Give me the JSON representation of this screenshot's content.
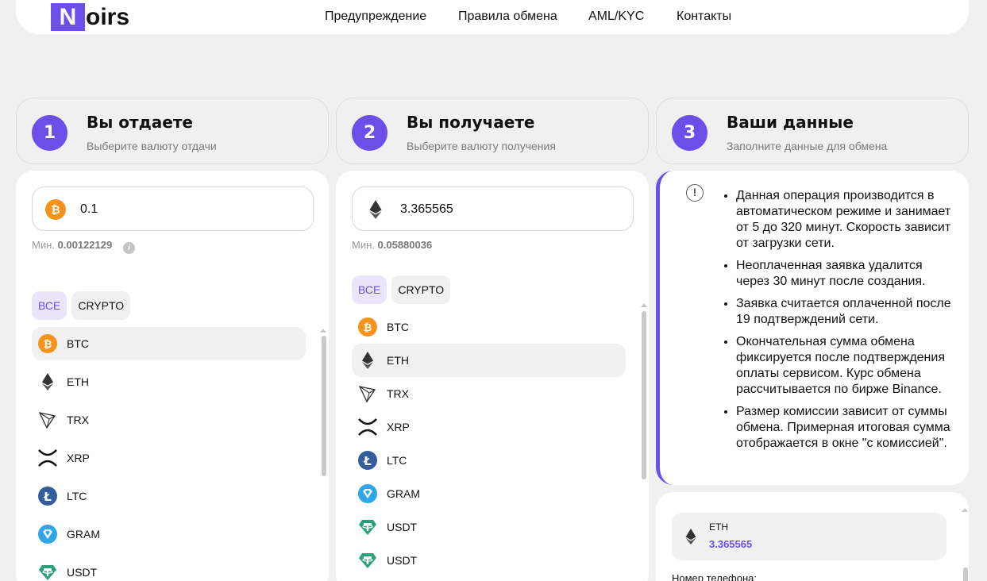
{
  "header": {
    "logo_letter": "N",
    "logo_rest": "oirs",
    "nav": [
      "Предупреждение",
      "Правила обмена",
      "AML/KYC",
      "Контакты"
    ]
  },
  "steps": [
    {
      "num": "1",
      "title": "Вы отдаете",
      "subtitle": "Выберите валюту отдачи"
    },
    {
      "num": "2",
      "title": "Вы получаете",
      "subtitle": "Выберите валюту получения"
    },
    {
      "num": "3",
      "title": "Ваши данные",
      "subtitle": "Заполните данные для обмена"
    }
  ],
  "give": {
    "amount": "0.1",
    "coin_icon": "btc-icon",
    "min_label": "Мин.",
    "min_value": "0.00122129",
    "filters": [
      "ВСЕ",
      "CRYPTO"
    ],
    "active_filter": "ВСЕ",
    "coins": [
      "BTC",
      "ETH",
      "TRX",
      "XRP",
      "LTC",
      "GRAM",
      "USDT"
    ],
    "selected": "BTC"
  },
  "receive": {
    "amount": "3.365565",
    "coin_icon": "eth-icon",
    "min_label": "Мин.",
    "min_value": "0.05880036",
    "filters": [
      "ВСЕ",
      "CRYPTO"
    ],
    "active_filter": "ВСЕ",
    "coins": [
      "BTC",
      "ETH",
      "TRX",
      "XRP",
      "LTC",
      "GRAM",
      "USDT",
      "USDT"
    ],
    "selected": "ETH"
  },
  "info": {
    "notes": [
      "Данная операция производится в автоматическом режиме и занимает от 5 до 320 минут. Скорость зависит от загрузки сети.",
      "Неоплаченная заявка удалится через 30 минут после создания.",
      "Заявка считается оплаченной после 19 подтверждений сети.",
      "Окончательная сумма обмена фиксируется после подтверждения оплаты сервисом. Курс обмена рассчитывается по бирже Binance.",
      "Размер комиссии зависит от суммы обмена. Примерная итоговая сумма отображается в окне \"с комиссией\"."
    ]
  },
  "summary": {
    "coin": "ETH",
    "amount": "3.365565",
    "phone_label": "Номер телефона:"
  },
  "colors": {
    "accent": "#6c4ee8",
    "btc": "#f7931a",
    "ltc": "#345d9d",
    "gram": "#2ea6e8",
    "usdt": "#26a17b"
  }
}
